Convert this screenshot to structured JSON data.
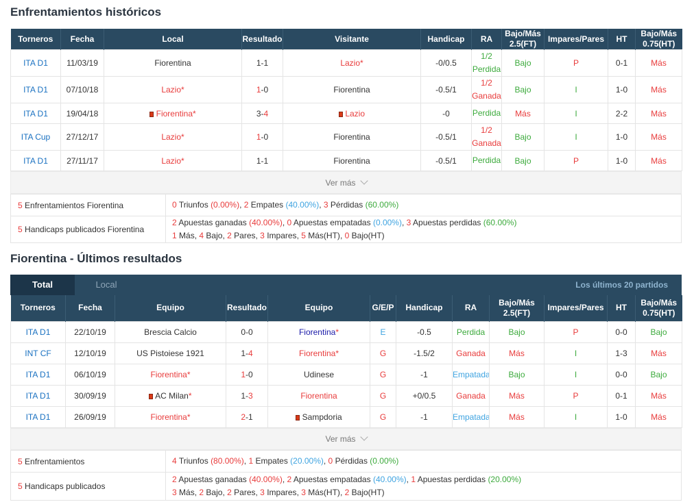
{
  "h2h": {
    "title": "Enfrentamientos históricos",
    "headers": [
      "Torneros",
      "Fecha",
      "Local",
      "Resultado",
      "Visitante",
      "Handicap",
      "RA",
      "Bajo/Más 2.5(FT)",
      "Impares/Pares",
      "HT",
      "Bajo/Más 0.75(HT)"
    ],
    "rows": [
      {
        "league": "ITA D1",
        "date": "11/03/19",
        "home": "Fiorentina",
        "home_star": "",
        "home_flag": false,
        "score_h": "1",
        "score_a": "1",
        "away": "Lazio",
        "away_star": "*",
        "away_flag": false,
        "handicap": "-0/0.5",
        "ra": "1/2 Perdida",
        "ou": "Bajo",
        "oe": "P",
        "ht": "0-1",
        "ou_ht": "Más"
      },
      {
        "league": "ITA D1",
        "date": "07/10/18",
        "home": "Lazio",
        "home_star": "*",
        "home_flag": false,
        "score_h": "1",
        "score_a": "0",
        "away": "Fiorentina",
        "away_star": "",
        "away_flag": false,
        "handicap": "-0.5/1",
        "ra": "1/2 Ganada",
        "ou": "Bajo",
        "oe": "I",
        "ht": "1-0",
        "ou_ht": "Más"
      },
      {
        "league": "ITA D1",
        "date": "19/04/18",
        "home": "Fiorentina",
        "home_star": "*",
        "home_flag": true,
        "score_h": "3",
        "score_a": "4",
        "away": "Lazio",
        "away_star": "",
        "away_flag": true,
        "handicap": "-0",
        "ra": "Perdida",
        "ou": "Más",
        "oe": "I",
        "ht": "2-2",
        "ou_ht": "Más"
      },
      {
        "league": "ITA Cup",
        "date": "27/12/17",
        "home": "Lazio",
        "home_star": "*",
        "home_flag": false,
        "score_h": "1",
        "score_a": "0",
        "away": "Fiorentina",
        "away_star": "",
        "away_flag": false,
        "handicap": "-0.5/1",
        "ra": "1/2 Ganada",
        "ou": "Bajo",
        "oe": "I",
        "ht": "1-0",
        "ou_ht": "Más"
      },
      {
        "league": "ITA D1",
        "date": "27/11/17",
        "home": "Lazio",
        "home_star": "*",
        "home_flag": false,
        "score_h": "1",
        "score_a": "1",
        "away": "Fiorentina",
        "away_star": "",
        "away_flag": false,
        "handicap": "-0.5/1",
        "ra": "Perdida",
        "ou": "Bajo",
        "oe": "P",
        "ht": "1-0",
        "ou_ht": "Más"
      }
    ],
    "more_label": "Ver más",
    "summary": {
      "line1_label_count": "5",
      "line1_label": "Enfrentamientos Fiorentina",
      "line1": [
        {
          "n": "0",
          "t": "Triunfos",
          "p": "(0.00%)",
          "c": "red"
        },
        {
          "n": "2",
          "t": "Empates",
          "p": "(40.00%)",
          "c": "lblue"
        },
        {
          "n": "3",
          "t": "Pérdidas",
          "p": "(60.00%)",
          "c": "green"
        }
      ],
      "line2_label_count": "5",
      "line2_label": "Handicaps publicados Fiorentina",
      "line2a": [
        {
          "n": "2",
          "t": "Apuestas ganadas",
          "p": "(40.00%)",
          "c": "red"
        },
        {
          "n": "0",
          "t": "Apuestas empatadas",
          "p": "(0.00%)",
          "c": "lblue"
        },
        {
          "n": "3",
          "t": "Apuestas perdidas",
          "p": "(60.00%)",
          "c": "green"
        }
      ],
      "line2b": [
        {
          "n": "1",
          "t": "Más"
        },
        {
          "n": "4",
          "t": "Bajo"
        },
        {
          "n": "2",
          "t": "Pares"
        },
        {
          "n": "3",
          "t": "Impares"
        },
        {
          "n": "5",
          "t": "Más(HT)"
        },
        {
          "n": "0",
          "t": "Bajo(HT)"
        }
      ]
    }
  },
  "recent": {
    "title": "Fiorentina - Últimos resultados",
    "tab_total": "Total",
    "tab_local": "Local",
    "last_label": "Los últimos 20 partidos",
    "headers": [
      "Torneros",
      "Fecha",
      "Equipo",
      "Resultado",
      "Equipo",
      "G/E/P",
      "Handicap",
      "RA",
      "Bajo/Más 2.5(FT)",
      "Impares/Pares",
      "HT",
      "Bajo/Más 0.75(HT)"
    ],
    "rows": [
      {
        "league": "ITA D1",
        "date": "22/10/19",
        "home": "Brescia Calcio",
        "home_star": "",
        "home_flag": false,
        "home_color": "dark",
        "score_h": "0",
        "score_a": "0",
        "away": "Fiorentina",
        "away_star": "*",
        "away_flag": false,
        "away_color": "navy",
        "gep": "E",
        "gep_color": "lblue",
        "handicap": "-0.5",
        "ra": "Perdida",
        "ra_color": "green",
        "ou": "Bajo",
        "ou_color": "green",
        "oe": "P",
        "oe_color": "red",
        "ht": "0-0",
        "ou_ht": "Bajo",
        "ou_ht_color": "green"
      },
      {
        "league": "INT CF",
        "date": "12/10/19",
        "home": "US Pistoiese 1921",
        "home_star": "",
        "home_flag": false,
        "home_color": "dark",
        "score_h": "1",
        "score_a": "4",
        "away": "Fiorentina",
        "away_star": "*",
        "away_flag": false,
        "away_color": "red",
        "gep": "G",
        "gep_color": "red",
        "handicap": "-1.5/2",
        "ra": "Ganada",
        "ra_color": "red",
        "ou": "Más",
        "ou_color": "red",
        "oe": "I",
        "oe_color": "green",
        "ht": "1-3",
        "ou_ht": "Más",
        "ou_ht_color": "red"
      },
      {
        "league": "ITA D1",
        "date": "06/10/19",
        "home": "Fiorentina",
        "home_star": "*",
        "home_flag": false,
        "home_color": "red",
        "score_h": "1",
        "score_a": "0",
        "away": "Udinese",
        "away_star": "",
        "away_flag": false,
        "away_color": "dark",
        "gep": "G",
        "gep_color": "red",
        "handicap": "-1",
        "ra": "Empatada",
        "ra_color": "lblue",
        "ou": "Bajo",
        "ou_color": "green",
        "oe": "I",
        "oe_color": "green",
        "ht": "0-0",
        "ou_ht": "Bajo",
        "ou_ht_color": "green"
      },
      {
        "league": "ITA D1",
        "date": "30/09/19",
        "home": "AC Milan",
        "home_star": "*",
        "home_flag": true,
        "home_color": "dark",
        "score_h": "1",
        "score_a": "3",
        "away": "Fiorentina",
        "away_star": "",
        "away_flag": false,
        "away_color": "red",
        "gep": "G",
        "gep_color": "red",
        "handicap": "+0/0.5",
        "ra": "Ganada",
        "ra_color": "red",
        "ou": "Más",
        "ou_color": "red",
        "oe": "P",
        "oe_color": "red",
        "ht": "0-1",
        "ou_ht": "Más",
        "ou_ht_color": "red"
      },
      {
        "league": "ITA D1",
        "date": "26/09/19",
        "home": "Fiorentina",
        "home_star": "*",
        "home_flag": false,
        "home_color": "red",
        "score_h": "2",
        "score_a": "1",
        "away": "Sampdoria",
        "away_star": "",
        "away_flag": true,
        "away_color": "dark",
        "gep": "G",
        "gep_color": "red",
        "handicap": "-1",
        "ra": "Empatada",
        "ra_color": "lblue",
        "ou": "Más",
        "ou_color": "red",
        "oe": "I",
        "oe_color": "green",
        "ht": "1-0",
        "ou_ht": "Más",
        "ou_ht_color": "red"
      }
    ],
    "more_label": "Ver más",
    "summary": {
      "line1_label_count": "5",
      "line1_label": "Enfrentamientos",
      "line1": [
        {
          "n": "4",
          "t": "Triunfos",
          "p": "(80.00%)",
          "c": "red"
        },
        {
          "n": "1",
          "t": "Empates",
          "p": "(20.00%)",
          "c": "lblue"
        },
        {
          "n": "0",
          "t": "Pérdidas",
          "p": "(0.00%)",
          "c": "green"
        }
      ],
      "line2_label_count": "5",
      "line2_label": "Handicaps publicados",
      "line2a": [
        {
          "n": "2",
          "t": "Apuestas ganadas",
          "p": "(40.00%)",
          "c": "red"
        },
        {
          "n": "2",
          "t": "Apuestas empatadas",
          "p": "(40.00%)",
          "c": "lblue"
        },
        {
          "n": "1",
          "t": "Apuestas perdidas",
          "p": "(20.00%)",
          "c": "green"
        }
      ],
      "line2b": [
        {
          "n": "3",
          "t": "Más"
        },
        {
          "n": "2",
          "t": "Bajo"
        },
        {
          "n": "2",
          "t": "Pares"
        },
        {
          "n": "3",
          "t": "Impares"
        },
        {
          "n": "3",
          "t": "Más(HT)"
        },
        {
          "n": "2",
          "t": "Bajo(HT)"
        }
      ]
    }
  }
}
